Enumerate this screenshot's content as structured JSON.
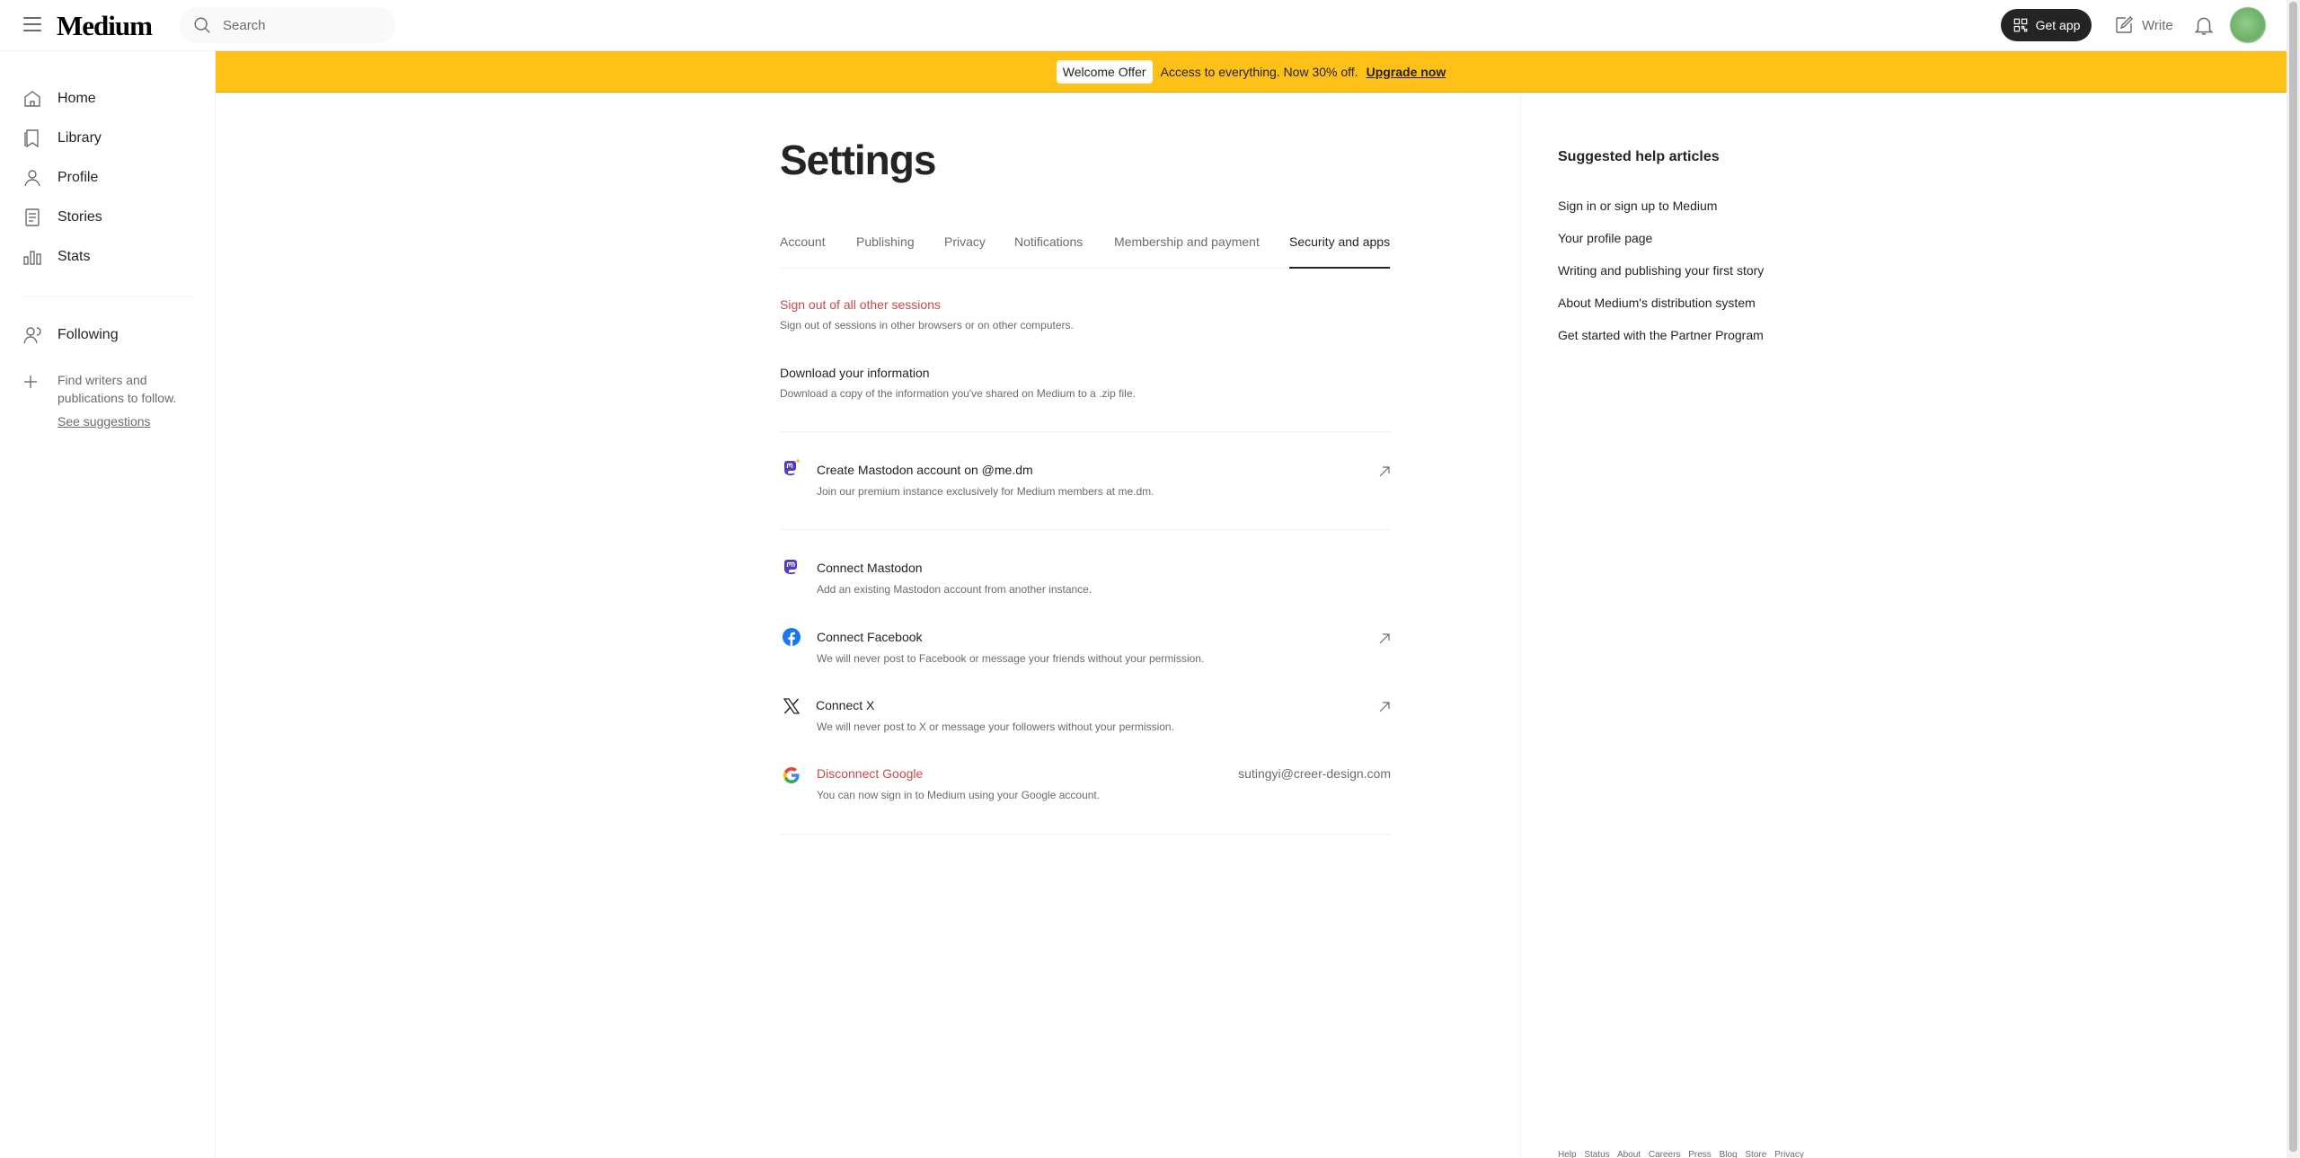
{
  "header": {
    "logo": "Medium",
    "search_placeholder": "Search",
    "get_app_label": "Get app",
    "write_label": "Write"
  },
  "sidebar": {
    "items": [
      {
        "label": "Home",
        "icon": "home-icon"
      },
      {
        "label": "Library",
        "icon": "bookmark-icon"
      },
      {
        "label": "Profile",
        "icon": "profile-icon"
      },
      {
        "label": "Stories",
        "icon": "stories-icon"
      },
      {
        "label": "Stats",
        "icon": "stats-icon"
      }
    ],
    "following_label": "Following",
    "find_text": "Find writers and publications to follow.",
    "see_suggestions": "See suggestions"
  },
  "banner": {
    "badge": "Welcome Offer",
    "text": "Access to everything. Now 30% off.",
    "link": "Upgrade now",
    "color": "#ffc017"
  },
  "settings": {
    "title": "Settings",
    "tabs": [
      "Account",
      "Publishing",
      "Privacy",
      "Notifications",
      "Membership and payment",
      "Security and apps"
    ],
    "active_tab": "Security and apps",
    "sign_out_title": "Sign out of all other sessions",
    "sign_out_desc": "Sign out of sessions in other browsers or on other computers.",
    "download_title": "Download your information",
    "download_desc": "Download a copy of the information you've shared on Medium to a .zip file.",
    "mastodon_create_title": "Create Mastodon account on @me.dm",
    "mastodon_create_desc": "Join our premium instance exclusively for Medium members at me.dm.",
    "mastodon_connect_title": "Connect Mastodon",
    "mastodon_connect_desc": "Add an existing Mastodon account from another instance.",
    "facebook_title": "Connect Facebook",
    "facebook_desc": "We will never post to Facebook or message your friends without your permission.",
    "x_title": "Connect X",
    "x_desc": "We will never post to X or message your followers without your permission.",
    "google_title": "Disconnect Google",
    "google_desc": "You can now sign in to Medium using your Google account.",
    "google_email": "sutingyi@creer-design.com"
  },
  "help": {
    "heading": "Suggested help articles",
    "links": [
      "Sign in or sign up to Medium",
      "Your profile page",
      "Writing and publishing your first story",
      "About Medium's distribution system",
      "Get started with the Partner Program"
    ]
  },
  "footer": {
    "links": [
      "Help",
      "Status",
      "About",
      "Careers",
      "Press",
      "Blog",
      "Store",
      "Privacy"
    ]
  }
}
